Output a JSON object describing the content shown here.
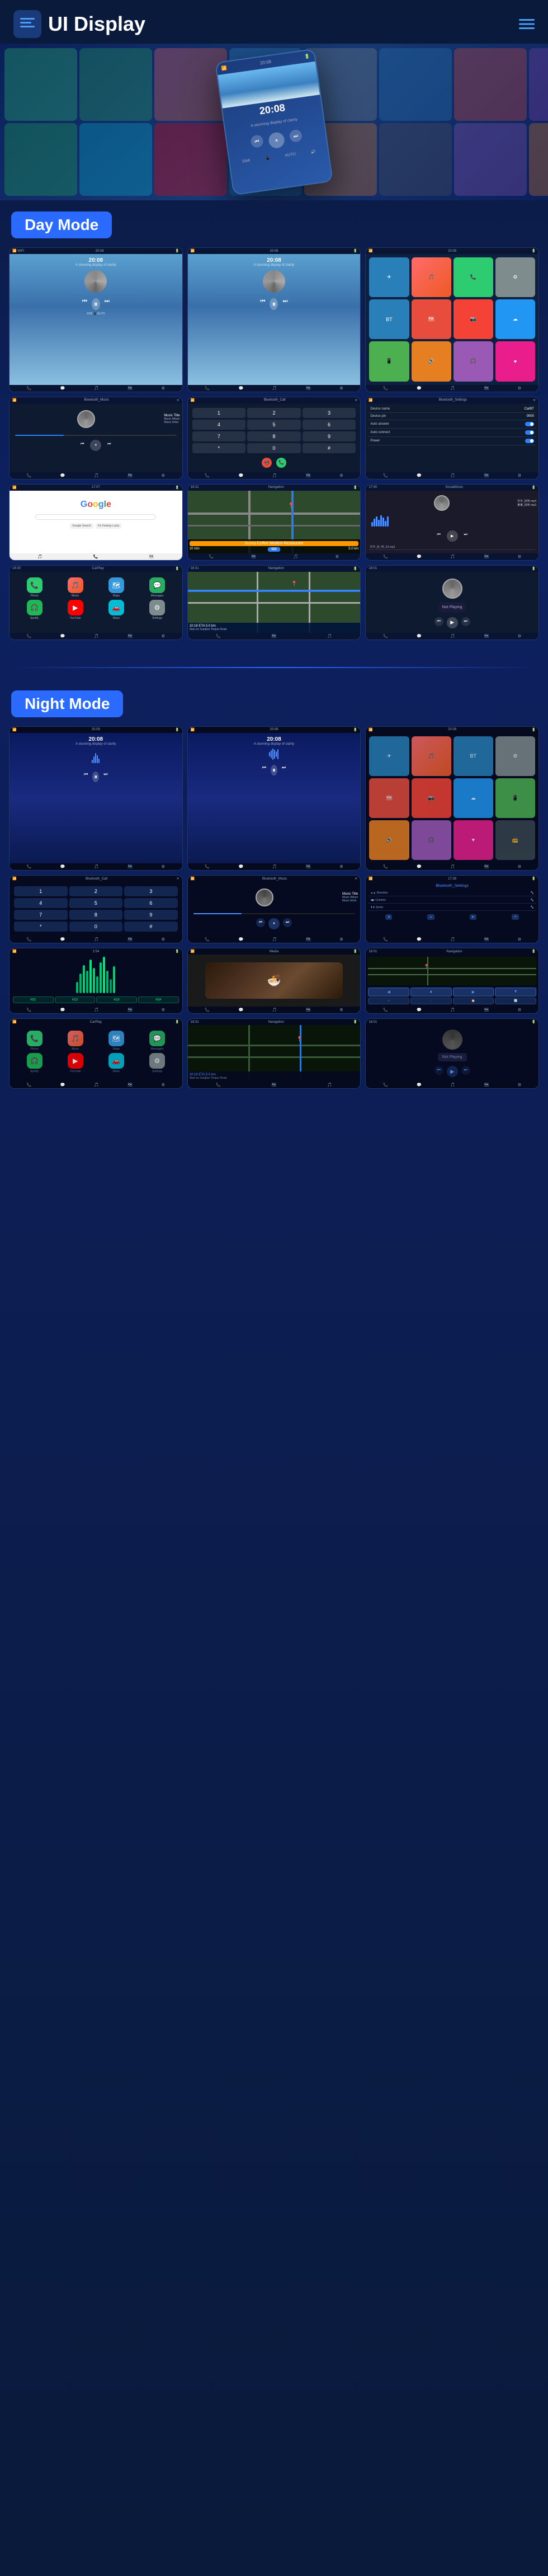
{
  "header": {
    "title": "UI Display",
    "menu_label": "☰",
    "dots_label": "⋮"
  },
  "modes": {
    "day": "Day Mode",
    "night": "Night Mode"
  },
  "screens": {
    "home_time": "20:08",
    "home_subtitle": "A stunning display of clarity",
    "music_title": "Music Title",
    "music_album": "Music Album",
    "music_artist": "Music Artist",
    "bt_music": "Bluetooth_Music",
    "bt_call": "Bluetooth_Call",
    "bt_settings": "Bluetooth_Settings",
    "device_name_label": "Device name",
    "device_name_val": "CarBT",
    "device_pin_label": "Device pin",
    "device_pin_val": "0000",
    "auto_answer_label": "Auto answer",
    "auto_connect_label": "Auto connect",
    "power_label": "Power",
    "social_music": "SocialMusic",
    "google_label": "Google",
    "sunny_coffee": "Sunny Coffee Modern Restaurant",
    "nav_eta": "10 min",
    "nav_dist": "5.0 km",
    "nav_road": "Start on Ganjbar Torque Road",
    "not_playing": "Not Playing",
    "go_btn": "GO"
  },
  "icons": {
    "phone": "📞",
    "music": "🎵",
    "maps": "🗺",
    "settings": "⚙",
    "bt": "🔵",
    "messages": "💬",
    "camera": "📷",
    "calendar": "📅",
    "nav": "🧭",
    "radio": "📻",
    "spotify": "🎧",
    "waze": "🚗",
    "apple": "🍎",
    "youtube": "▶",
    "telegram": "✈",
    "home": "🏠",
    "back": "◀",
    "play": "▶",
    "pause": "⏸",
    "prev": "⏮",
    "next": "⏭",
    "search": "🔍",
    "gear": "⚙",
    "menu": "☰",
    "dots": "⋮⋮⋮"
  },
  "wave_heights": [
    8,
    14,
    20,
    16,
    10,
    22,
    18,
    12,
    25,
    20,
    14,
    8,
    18,
    24,
    16,
    10,
    20,
    15,
    22,
    12
  ],
  "numpad": [
    "1",
    "2",
    "3",
    "4",
    "5",
    "6",
    "7",
    "8",
    "9",
    "*",
    "0",
    "#"
  ],
  "social_tracks": [
    "华平_好_听.mp4",
    "某某_好_听.mp3",
    "华平_好_听_02.mp3"
  ],
  "app_icons_day": [
    {
      "color": "ic-phone",
      "icon": "📞"
    },
    {
      "color": "ic-messages",
      "icon": "💬"
    },
    {
      "color": "ic-music",
      "icon": "🎵"
    },
    {
      "color": "ic-maps",
      "icon": "🗺"
    },
    {
      "color": "ic-settings",
      "icon": "⚙"
    },
    {
      "color": "ic-bt",
      "icon": "🔵"
    },
    {
      "color": "ic-nav",
      "icon": "🧭"
    },
    {
      "color": "ic-camera",
      "icon": "📷"
    }
  ]
}
